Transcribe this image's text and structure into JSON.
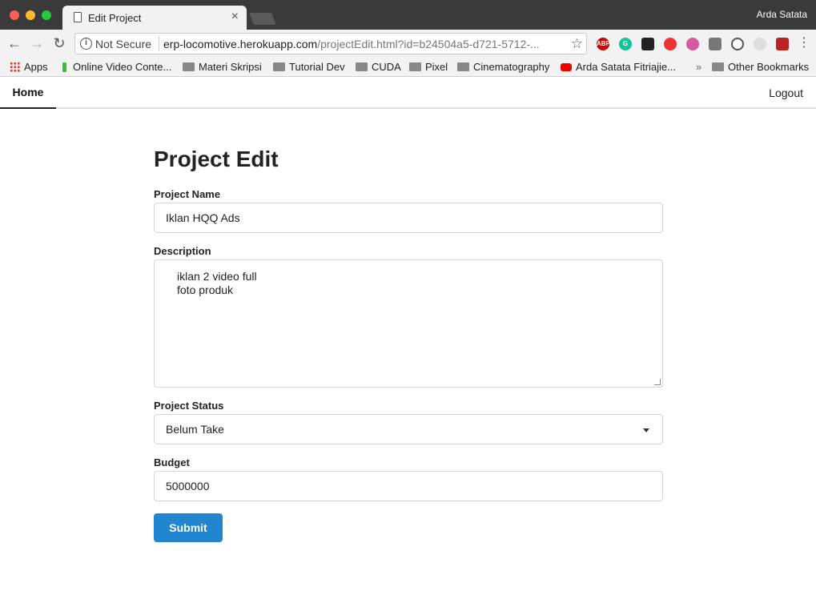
{
  "browser": {
    "tab_title": "Edit Project",
    "profile_name": "Arda Satata",
    "security_label": "Not Secure",
    "url_host": "erp-locomotive.herokuapp.com",
    "url_rest": "/projectEdit.html?id=b24504a5-d721-5712-...",
    "bookmarks": [
      "Apps",
      "Online Video Conte...",
      "Materi Skripsi",
      "Tutorial Dev",
      "CUDA",
      "Pixel",
      "Cinematography",
      "Arda Satata Fitriajie...",
      "Other Bookmarks"
    ],
    "extensions": [
      "ABP",
      "G",
      "",
      "",
      "",
      "",
      "",
      "",
      ""
    ]
  },
  "nav": {
    "home": "Home",
    "logout": "Logout"
  },
  "form": {
    "title": "Project Edit",
    "project_name_label": "Project Name",
    "project_name_value": "Iklan HQQ Ads",
    "description_label": "Description",
    "description_value": "iklan 2 video full\nfoto produk",
    "status_label": "Project Status",
    "status_value": "Belum Take",
    "budget_label": "Budget",
    "budget_value": "5000000",
    "submit_label": "Submit"
  },
  "colors": {
    "primary": "#2185d0",
    "titlebar": "#3a3a3a"
  }
}
